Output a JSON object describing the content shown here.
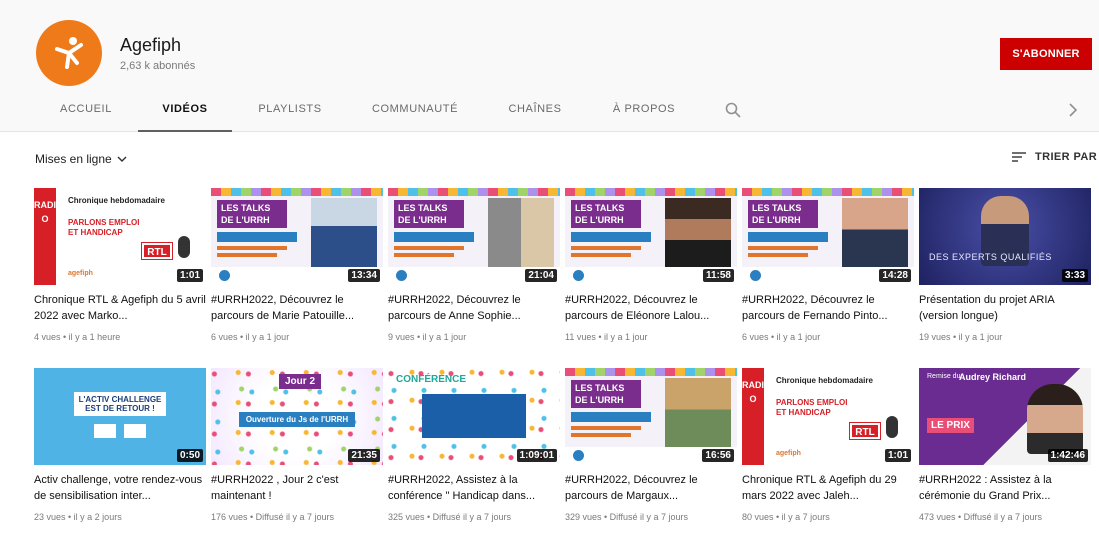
{
  "channel": {
    "name": "Agefiph",
    "subscribers": "2,63 k abonnés",
    "subscribe_label": "S'ABONNER"
  },
  "tabs": [
    {
      "label": "ACCUEIL",
      "active": false
    },
    {
      "label": "VIDÉOS",
      "active": true
    },
    {
      "label": "PLAYLISTS",
      "active": false
    },
    {
      "label": "COMMUNAUTÉ",
      "active": false
    },
    {
      "label": "CHAÎNES",
      "active": false
    },
    {
      "label": "À PROPOS",
      "active": false
    }
  ],
  "toolbar": {
    "uploads_label": "Mises en ligne",
    "sort_label": "TRIER PAR"
  },
  "icons": {
    "search": "search-icon",
    "next": "chevron-right-icon",
    "dropdown": "chevron-down-icon",
    "sort": "sort-icon"
  },
  "colors": {
    "brand_orange": "#ef7a1a",
    "subscribe_red": "#cc0000",
    "urrh_purple": "#7b2d8e"
  },
  "thumb_texts": {
    "radio": "RADIO",
    "chronique": "Chronique hebdomadaire",
    "parlons": "PARLONS EMPLOI ET HANDICAP",
    "rtl": "RTL",
    "agefiph": "agefiph",
    "urrh": "LES TALKS DE L'URRH",
    "experts": "DES EXPERTS QUALIFIÉS",
    "activ": "L'ACTIV CHALLENGE EST DE RETOUR !",
    "jour2": "Jour 2",
    "ouverture": "Ouverture du Js de l'URRH",
    "conference": "CONFÉRENCE",
    "remise": "Remise du",
    "audrey": "Audrey Richard",
    "prix": "LE PRIX"
  },
  "videos": [
    {
      "title": "Chronique RTL & Agefiph du 5 avril 2022 avec Marko...",
      "duration": "1:01",
      "meta": "4 vues • il y a 1 heure"
    },
    {
      "title": "#URRH2022, Découvrez le parcours de Marie Patouille...",
      "duration": "13:34",
      "meta": "6 vues • il y a 1 jour"
    },
    {
      "title": "#URRH2022, Découvrez le parcours de Anne Sophie...",
      "duration": "21:04",
      "meta": "9 vues • il y a 1 jour"
    },
    {
      "title": "#URRH2022, Découvrez le parcours de Eléonore Lalou...",
      "duration": "11:58",
      "meta": "11 vues • il y a 1 jour"
    },
    {
      "title": "#URRH2022, Découvrez le parcours de Fernando Pinto...",
      "duration": "14:28",
      "meta": "6 vues • il y a 1 jour"
    },
    {
      "title": "Présentation du projet ARIA (version longue)",
      "duration": "3:33",
      "meta": "19 vues • il y a 1 jour"
    },
    {
      "title": "Activ challenge, votre rendez-vous de sensibilisation inter...",
      "duration": "0:50",
      "meta": "23 vues • il y a 2 jours"
    },
    {
      "title": "#URRH2022 , Jour 2 c'est maintenant !",
      "duration": "21:35",
      "meta": "176 vues • Diffusé il y a 7 jours"
    },
    {
      "title": "#URRH2022, Assistez à la conférence \" Handicap dans...",
      "duration": "1:09:01",
      "meta": "325 vues • Diffusé il y a 7 jours"
    },
    {
      "title": "#URRH2022, Découvrez le parcours de Margaux...",
      "duration": "16:56",
      "meta": "329 vues • Diffusé il y a 7 jours"
    },
    {
      "title": "Chronique RTL & Agefiph du 29 mars 2022 avec Jaleh...",
      "duration": "1:01",
      "meta": "80 vues • il y a 7 jours"
    },
    {
      "title": "#URRH2022 : Assistez à la cérémonie du Grand Prix...",
      "duration": "1:42:46",
      "meta": "473 vues • Diffusé il y a 7 jours"
    }
  ]
}
